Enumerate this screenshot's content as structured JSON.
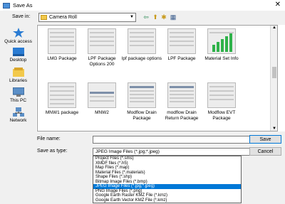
{
  "window": {
    "title": "Save As",
    "close_glyph": "✕"
  },
  "toolbar": {
    "save_in_label": "Save in:",
    "location": "Camera Roll",
    "dropdown_glyph": "▼",
    "buttons": [
      {
        "name": "back-icon",
        "glyph": "⇦"
      },
      {
        "name": "up-folder-icon",
        "glyph": "⬆"
      },
      {
        "name": "new-folder-icon",
        "glyph": "✱"
      },
      {
        "name": "view-menu-icon",
        "glyph": "▦"
      }
    ]
  },
  "places": [
    {
      "label": "Quick access",
      "icon": "star-icon"
    },
    {
      "label": "Desktop",
      "icon": "desktop-icon"
    },
    {
      "label": "Libraries",
      "icon": "libraries-icon"
    },
    {
      "label": "This PC",
      "icon": "computer-icon"
    },
    {
      "label": "Network",
      "icon": "network-icon"
    }
  ],
  "files": [
    {
      "label": "LMG Package",
      "thumb": "form"
    },
    {
      "label": "LPF Package Options 200",
      "thumb": "form"
    },
    {
      "label": "lpf package options",
      "thumb": "form"
    },
    {
      "label": "LPF Package",
      "thumb": "form"
    },
    {
      "label": "Material Set Info",
      "thumb": "chart"
    },
    {
      "label": "MNW1 package",
      "thumb": "form"
    },
    {
      "label": "MNW2",
      "thumb": "table"
    },
    {
      "label": "Modflow Drain Package",
      "thumb": "table"
    },
    {
      "label": "modflow Drain Return Package",
      "thumb": "table"
    },
    {
      "label": "Modflow EVT Package",
      "thumb": "form"
    }
  ],
  "form": {
    "file_name_label": "File name:",
    "file_name_value": "",
    "save_as_type_label": "Save as type:",
    "save_as_type_value": "JPEG Image Files (*.jpg;*.jpeg)",
    "save_button": "Save",
    "cancel_button": "Cancel"
  },
  "file_types": {
    "options": [
      "Project Files (*.sms)",
      "XMDF files (*.h5)",
      "Map Files (*.map)",
      "Material Files (*.materials)",
      "Shape Files (*.shp)",
      "Bitmap Image Files (*.bmp)",
      "JPEG Image Files (*.jpg;*.jpeg)",
      "PNG Image Files (*.png)",
      "Google Earth Raster KMZ File (*.kmz)",
      "Google Earth Vector KMZ File (*.kmz)"
    ],
    "selected_index": 6
  },
  "colors": {
    "selection": "#0078d7",
    "dialog_bg": "#f0f0f0",
    "folder": "#f2c94c"
  }
}
